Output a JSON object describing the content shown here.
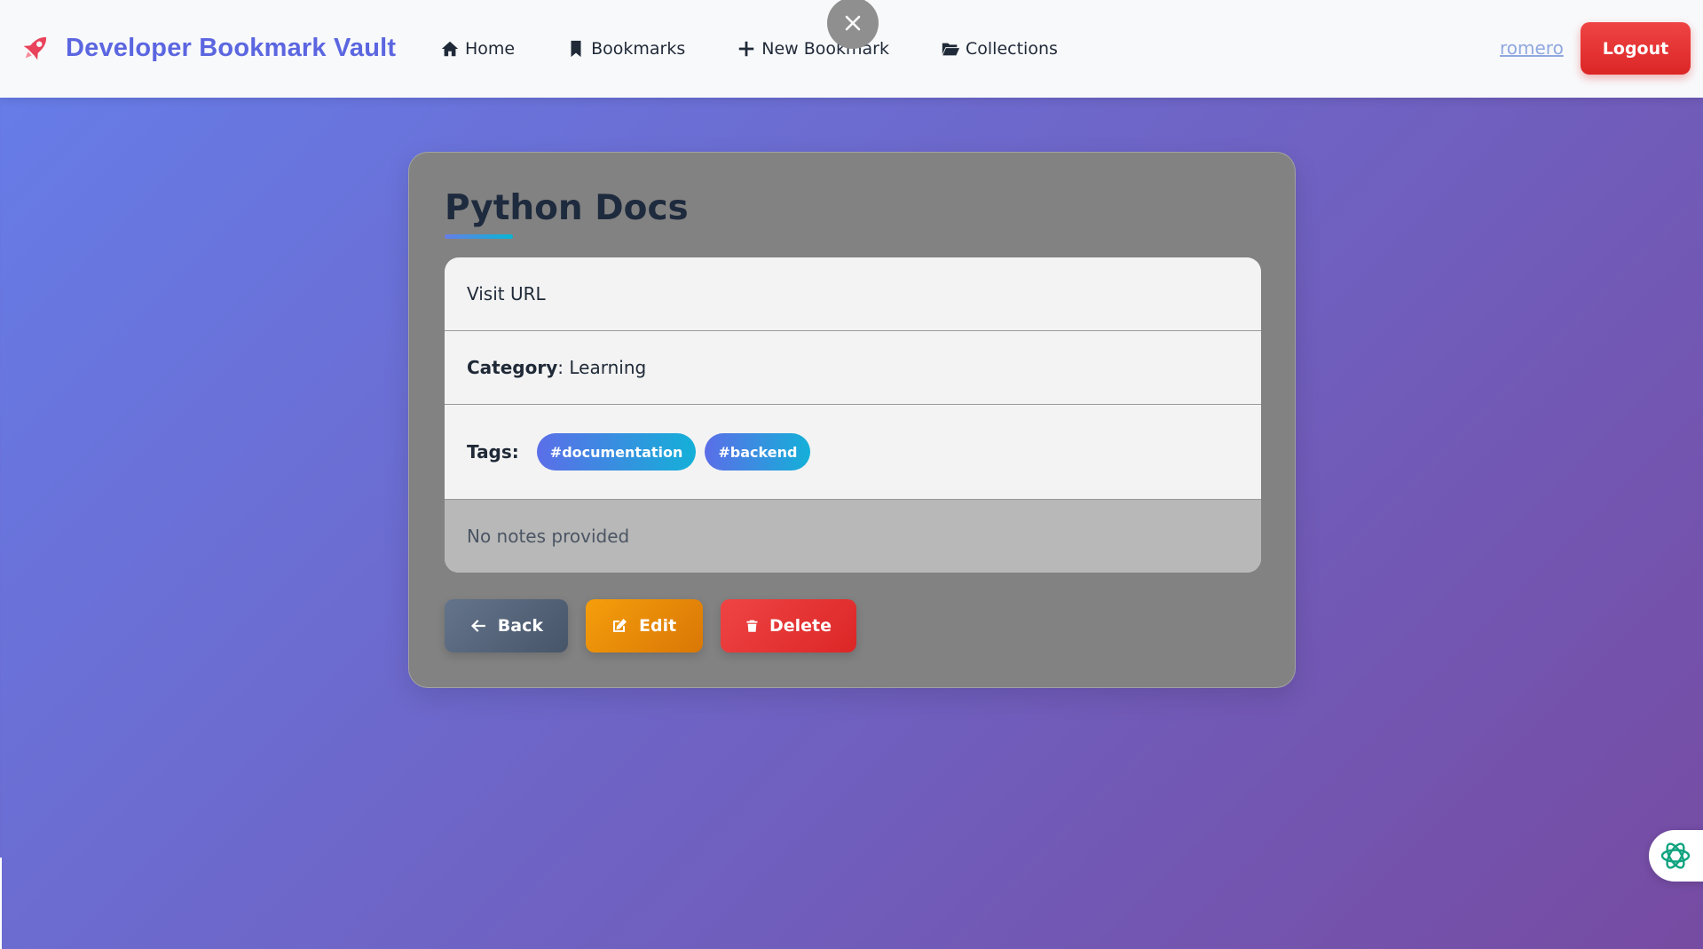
{
  "navbar": {
    "brand": "Developer Bookmark Vault",
    "links": [
      {
        "label": "Home",
        "icon": "home-icon"
      },
      {
        "label": "Bookmarks",
        "icon": "bookmark-icon"
      },
      {
        "label": "New Bookmark",
        "icon": "plus-icon"
      },
      {
        "label": "Collections",
        "icon": "folder-open-icon"
      }
    ],
    "username": "romero",
    "logout_label": "Logout"
  },
  "bookmark": {
    "title": "Python Docs",
    "url_label": "Visit URL",
    "category_label": "Category",
    "category_value": ": Learning",
    "tags_label": "Tags:",
    "tags": [
      "#documentation",
      "#backend"
    ],
    "notes": "No notes provided"
  },
  "actions": {
    "back_label": "Back",
    "edit_label": "Edit",
    "delete_label": "Delete"
  },
  "colors": {
    "brand": "#5b66e0",
    "logout": "#dc2626",
    "edit": "#f59e0b",
    "delete": "#ef4444",
    "back": "#64748b",
    "background_start": "#667eea",
    "background_end": "#764ba2"
  }
}
